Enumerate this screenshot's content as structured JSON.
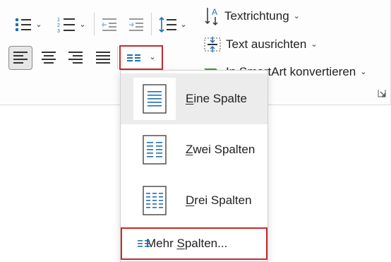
{
  "colors": {
    "accent_blue": "#1f6fb2",
    "highlight_red": "#c42b2f",
    "hover_gray": "#ececec",
    "ribbon_bg": "#fdfdfd"
  },
  "ribbon": {
    "row1": {
      "bullets_icon": "bullets-icon",
      "numbering_icon": "numbering-icon",
      "decrease_indent_icon": "decrease-indent-icon",
      "increase_indent_icon": "increase-indent-icon",
      "line_spacing_icon": "line-spacing-icon"
    },
    "row2": {
      "align_left_icon": "align-left-icon",
      "align_center_icon": "align-center-icon",
      "align_right_icon": "align-right-icon",
      "justify_icon": "justify-icon",
      "columns_icon": "columns-icon"
    },
    "commands": {
      "text_direction": "Textrichtung",
      "align_text": "Text ausrichten",
      "convert_smartart": "In SmartArt konvertieren"
    }
  },
  "dropdown": {
    "items": [
      {
        "prefix": "",
        "accel": "E",
        "rest": "ine Spalte",
        "columns": 1,
        "selected": true
      },
      {
        "prefix": "",
        "accel": "Z",
        "rest": "wei Spalten",
        "columns": 2,
        "selected": false
      },
      {
        "prefix": "",
        "accel": "D",
        "rest": "rei Spalten",
        "columns": 3,
        "selected": false
      }
    ],
    "more": {
      "prefix": "Mehr ",
      "accel": "S",
      "rest": "palten..."
    }
  }
}
